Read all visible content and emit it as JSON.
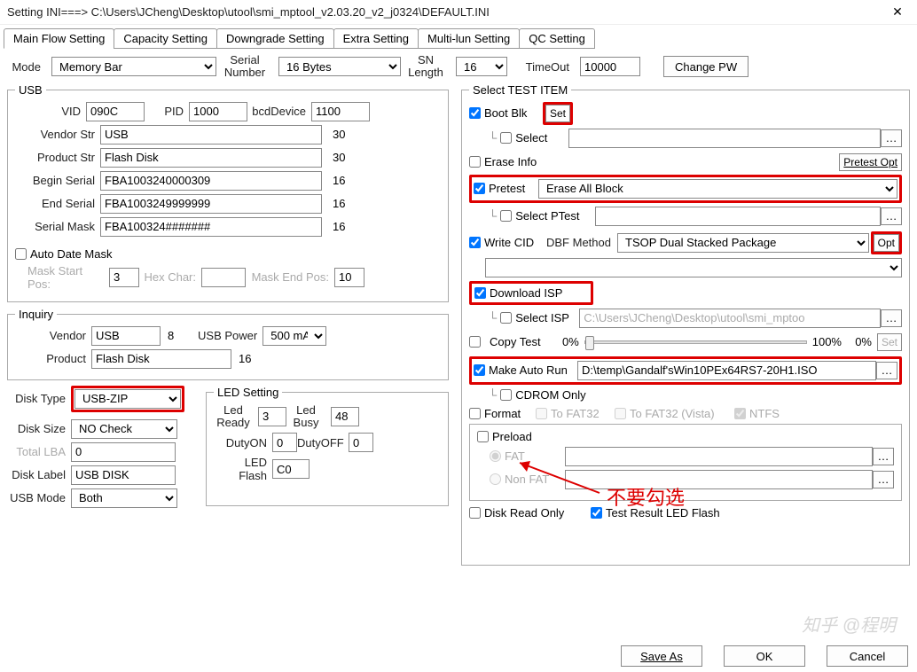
{
  "title": "Setting  INI===>  C:\\Users\\JCheng\\Desktop\\utool\\smi_mptool_v2.03.20_v2_j0324\\DEFAULT.INI",
  "tabs": [
    "Main Flow Setting",
    "Capacity Setting",
    "Downgrade Setting",
    "Extra Setting",
    "Multi-lun Setting",
    "QC Setting"
  ],
  "topbar": {
    "mode_label": "Mode",
    "mode_value": "Memory Bar",
    "serial_number_label": "Serial\nNumber",
    "serial_number_value": "16 Bytes",
    "sn_length_label": "SN\nLength",
    "sn_length_value": "16",
    "timeout_label": "TimeOut",
    "timeout_value": "10000",
    "change_pw": "Change PW"
  },
  "usb": {
    "legend": "USB",
    "vid_label": "VID",
    "vid": "090C",
    "pid_label": "PID",
    "pid": "1000",
    "bcd_label": "bcdDevice",
    "bcd": "1100",
    "vendor_str_label": "Vendor Str",
    "vendor_str": "USB",
    "vendor_str_max": "30",
    "product_str_label": "Product Str",
    "product_str": "Flash Disk",
    "product_str_max": "30",
    "begin_serial_label": "Begin Serial",
    "begin_serial": "FBA1003240000309",
    "begin_serial_max": "16",
    "end_serial_label": "End Serial",
    "end_serial": "FBA1003249999999",
    "end_serial_max": "16",
    "serial_mask_label": "Serial Mask",
    "serial_mask": "FBA100324#######",
    "serial_mask_max": "16",
    "auto_date_mask": "Auto Date Mask",
    "mask_start_label": "Mask Start Pos:",
    "mask_start": "3",
    "hex_char_label": "Hex Char:",
    "mask_end_label": "Mask End Pos:",
    "mask_end": "10"
  },
  "inquiry": {
    "legend": "Inquiry",
    "vendor_label": "Vendor",
    "vendor": "USB",
    "vendor_max": "8",
    "usb_power_label": "USB Power",
    "usb_power": "500 mA",
    "product_label": "Product",
    "product": "Flash Disk",
    "product_max": "16"
  },
  "disk_type_label": "Disk Type",
  "disk_type": "USB-ZIP",
  "disk_size_label": "Disk Size",
  "disk_size": "NO Check",
  "total_lba_label": "Total LBA",
  "total_lba": "0",
  "disk_label_label": "Disk Label",
  "disk_label": "USB DISK",
  "usb_mode_label": "USB Mode",
  "usb_mode": "Both",
  "led": {
    "legend": "LED Setting",
    "ready_label": "Led\nReady",
    "ready": "3",
    "busy_label": "Led\nBusy",
    "busy": "48",
    "dutyon_label": "DutyON",
    "dutyon": "0",
    "dutyoff_label": "DutyOFF",
    "dutyoff": "0",
    "flash_label": "LED Flash",
    "flash": "C0"
  },
  "test": {
    "legend": "Select TEST ITEM",
    "boot_blk": "Boot Blk",
    "set_btn": "Set",
    "select": "Select",
    "erase_info": "Erase Info",
    "pretest_opt": "Pretest Opt",
    "pretest": "Pretest",
    "pretest_value": "Erase All Block",
    "select_ptest": "Select PTest",
    "write_cid": "Write CID",
    "dbf_label": "DBF Method",
    "dbf_value": "TSOP Dual Stacked Package",
    "opt": "Opt",
    "download_isp": "Download ISP",
    "select_isp": "Select ISP",
    "isp_path": "C:\\Users\\JCheng\\Desktop\\utool\\smi_mptoo",
    "copy_test": "Copy Test",
    "pct0": "0%",
    "pct100": "100%",
    "pct_val": "0%",
    "set_copy": "Set",
    "make_autorun": "Make Auto Run",
    "autorun_path": "D:\\temp\\Gandalf'sWin10PEx64RS7-20H1.ISO",
    "cdrom_only": "CDROM Only",
    "format": "Format",
    "to_fat32": "To FAT32",
    "to_fat32_vista": "To FAT32 (Vista)",
    "ntfs": "NTFS",
    "preload": "Preload",
    "fat": "FAT",
    "nonfat": "Non FAT",
    "disk_ro": "Disk Read Only",
    "test_result_led": "Test Result LED Flash"
  },
  "annotation": "不要勾选",
  "footer": {
    "save_as": "Save  As",
    "ok": "OK",
    "cancel": "Cancel"
  },
  "watermark": "知乎 @程明"
}
